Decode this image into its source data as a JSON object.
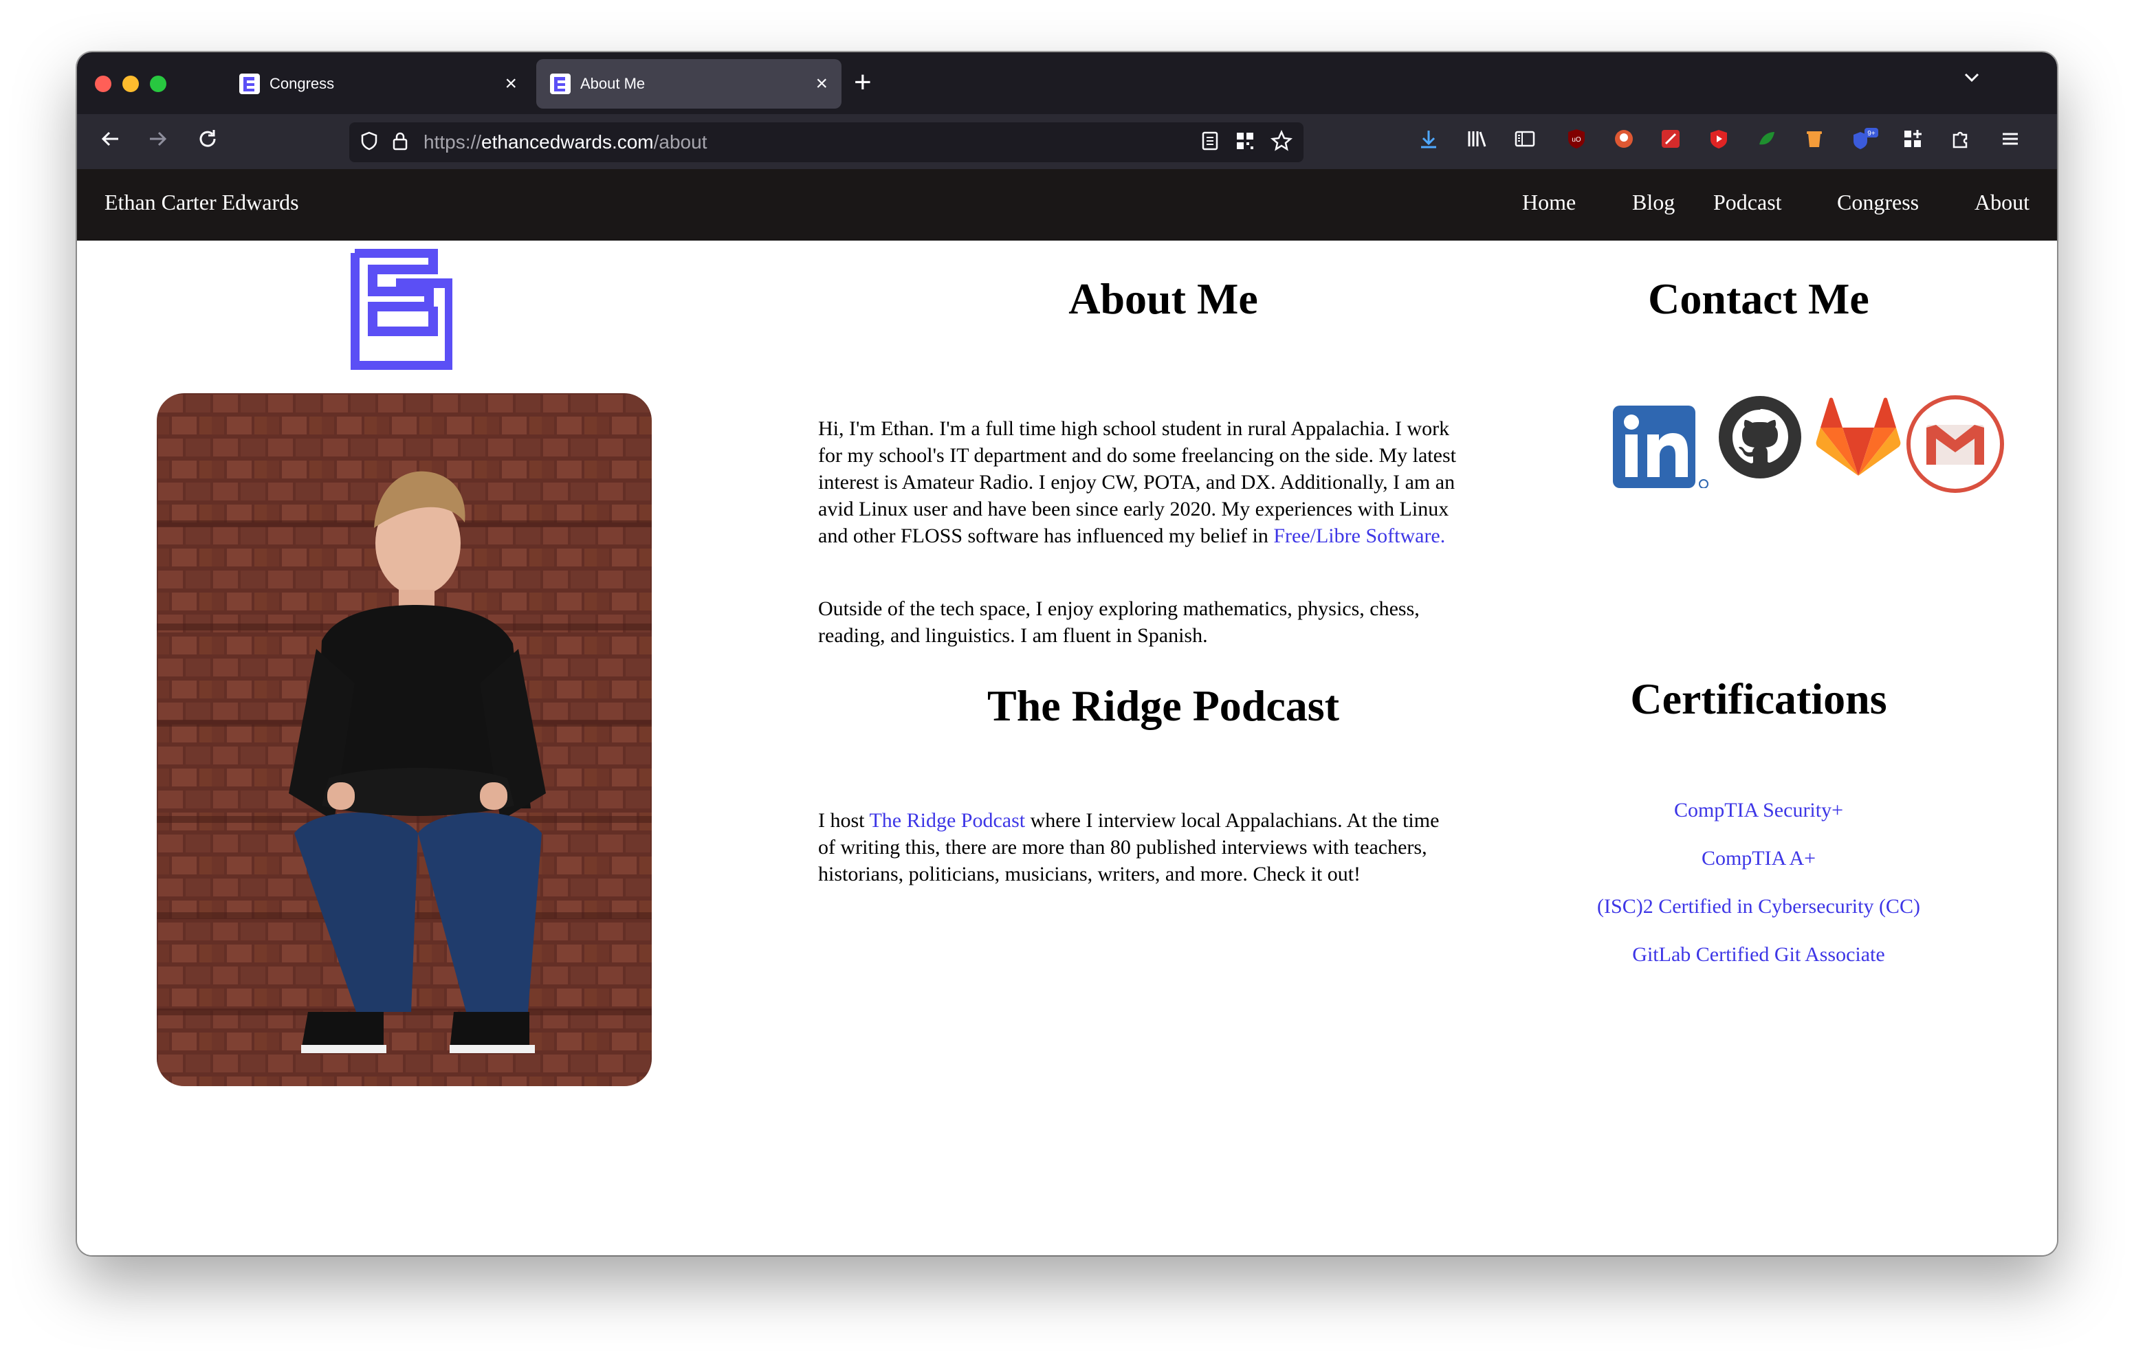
{
  "browser": {
    "tabs": [
      {
        "title": "Congress",
        "active": false
      },
      {
        "title": "About Me",
        "active": true
      }
    ],
    "url": {
      "scheme": "https://",
      "host": "ethancedwards.com",
      "path": "/about"
    },
    "extension_badge": "9+"
  },
  "site": {
    "brand": "Ethan Carter Edwards",
    "nav": [
      "Home",
      "Blog",
      "Podcast",
      "Congress",
      "About"
    ]
  },
  "about": {
    "title": "About Me",
    "p1_text": "Hi, I'm Ethan. I'm a full time high school student in rural Appalachia. I work for my school's IT department and do some freelancing on the side. My latest interest is Amateur Radio. I enjoy CW, POTA, and DX. Additionally, I am an avid Linux user and have been since early 2020. My experiences with Linux and other FLOSS software has influenced my belief in ",
    "p1_link": "Free/Libre Software.",
    "p2_text": "Outside of the tech space, I enjoy exploring mathematics, physics, chess, reading, and linguistics. I am fluent in Spanish."
  },
  "podcast": {
    "title": "The Ridge Podcast",
    "text_before": "I host ",
    "link": "The Ridge Podcast",
    "text_after": " where I interview local Appalachians. At the time of writing this, there are more than 80 published interviews with teachers, historians, politicians, musicians, writers, and more. Check it out!"
  },
  "contact": {
    "title": "Contact Me",
    "icons": [
      "linkedin-icon",
      "github-icon",
      "gitlab-icon",
      "gmail-icon"
    ]
  },
  "certifications": {
    "title": "Certifications",
    "items": [
      "CompTIA Security+",
      "CompTIA A+",
      "(ISC)2 Certified in Cybersecurity (CC)",
      "GitLab Certified Git Associate"
    ]
  },
  "colors": {
    "accent": "#3d36e6",
    "logo": "#5b4ff5",
    "nav_bg": "#1a1717"
  }
}
